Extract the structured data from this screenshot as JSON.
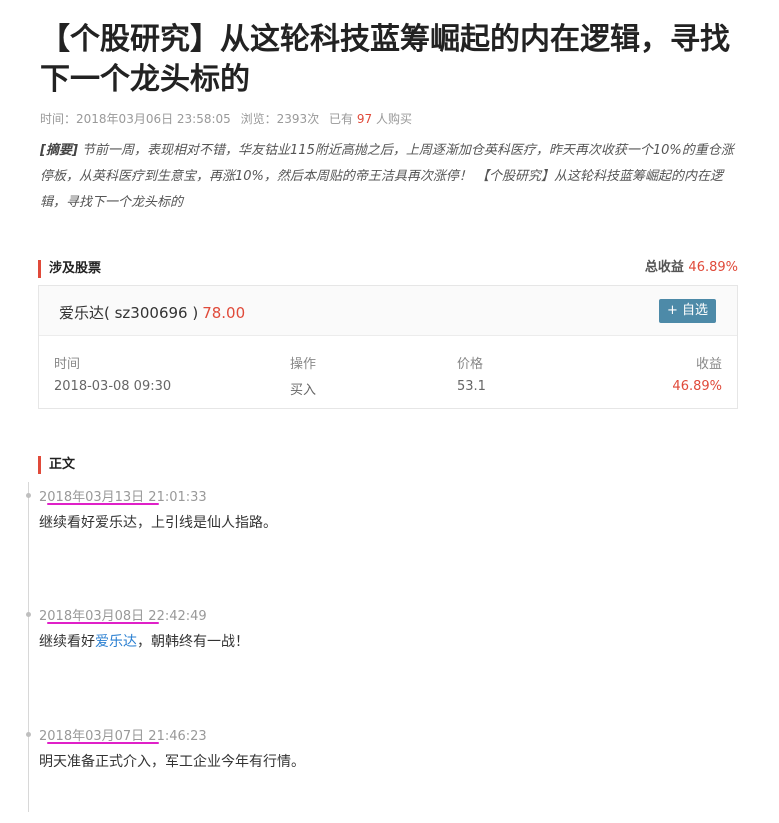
{
  "article": {
    "title": "【个股研究】从这轮科技蓝筹崛起的内在逻辑，寻找下一个龙头标的",
    "meta": {
      "time_label": "时间：",
      "time": "2018年03月06日 23:58:05",
      "views_label": "浏览：",
      "views": "2393次",
      "buyers_prefix": "已有",
      "buyers": "97",
      "buyers_suffix": "人购买"
    },
    "abstract": {
      "tag": "[摘要]",
      "text": "节前一周，表现相对不错，华友钴业115附近高抛之后，上周逐渐加仓英科医疗，昨天再次收获一个10%的重仓涨停板，从英科医疗到生意宝，再涨10%，然后本周贴的帝王洁具再次涨停！ 【个股研究】从这轮科技蓝筹崛起的内在逻辑，寻找下一个龙头标的"
    }
  },
  "stocks_section": {
    "heading": "涉及股票",
    "total_label": "总收益",
    "total_value": "46.89%",
    "stock": {
      "name": "爱乐达( sz300696 )",
      "price": "78.00",
      "fav_button": "+ 自选"
    },
    "table": {
      "headers": [
        "时间",
        "操作",
        "价格",
        "收益"
      ],
      "rows": [
        [
          "2018-03-08 09:30",
          "买入",
          "53.1",
          "46.89%"
        ]
      ]
    }
  },
  "body_section": {
    "heading": "正文",
    "entries": [
      {
        "timestamp": "2018年03月13日 21:01:33",
        "text": "继续看好爱乐达，上引线是仙人指路。"
      },
      {
        "timestamp": "2018年03月08日 22:42:49",
        "text_before": "继续看好",
        "link": "爱乐达",
        "text_after": "，朝韩终有一战！"
      },
      {
        "timestamp": "2018年03月07日 21:46:23",
        "text": "明天准备正式介入，军工企业今年有行情。"
      }
    ]
  },
  "colors": {
    "accent_red": "#e04a3a",
    "button_blue": "#4d8aa8",
    "link_blue": "#2a7fd1",
    "annotation_magenta": "#e020c8"
  }
}
